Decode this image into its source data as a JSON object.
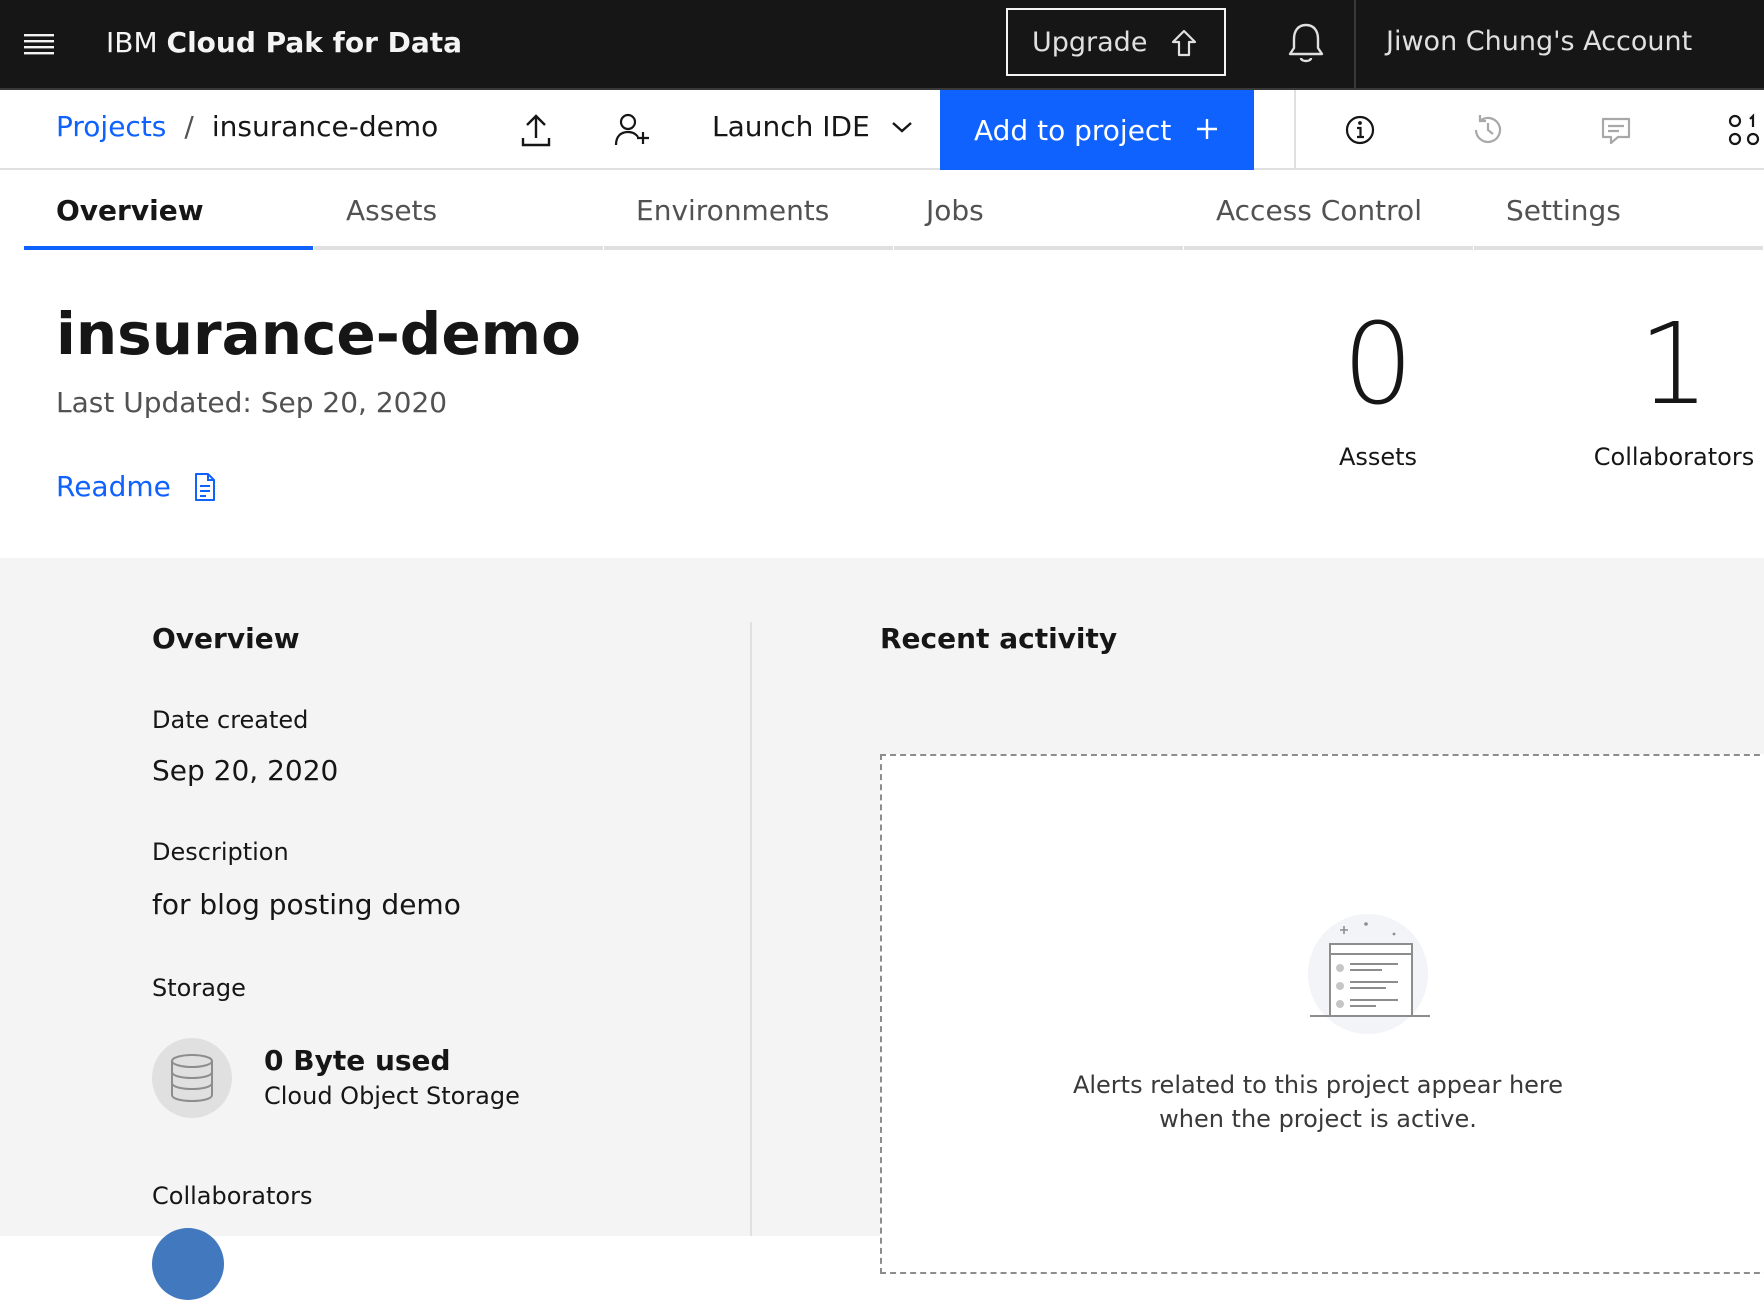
{
  "header": {
    "brand_ibm": "IBM",
    "brand_product": "Cloud Pak for Data",
    "upgrade_label": "Upgrade",
    "account_label": "Jiwon Chung's Account"
  },
  "toolbar": {
    "breadcrumb": {
      "parent": "Projects",
      "separator": "/",
      "current": "insurance-demo"
    },
    "launch_ide_label": "Launch IDE",
    "add_to_project_label": "Add to project"
  },
  "tabs": [
    {
      "label": "Overview",
      "active": true
    },
    {
      "label": "Assets",
      "active": false
    },
    {
      "label": "Environments",
      "active": false
    },
    {
      "label": "Jobs",
      "active": false
    },
    {
      "label": "Access Control",
      "active": false
    },
    {
      "label": "Settings",
      "active": false
    }
  ],
  "project": {
    "title": "insurance-demo",
    "last_updated": "Last Updated: Sep 20, 2020",
    "readme_label": "Readme",
    "stats": [
      {
        "value": "0",
        "label": "Assets"
      },
      {
        "value": "1",
        "label": "Collaborators"
      }
    ]
  },
  "overview": {
    "title": "Overview",
    "date_created_label": "Date created",
    "date_created_value": "Sep 20, 2020",
    "description_label": "Description",
    "description_value": "for blog posting demo",
    "storage_label": "Storage",
    "storage_used": "0 Byte used",
    "storage_type": "Cloud Object Storage",
    "collaborators_label": "Collaborators"
  },
  "recent_activity": {
    "title": "Recent activity",
    "empty_line1": "Alerts related to this project appear here",
    "empty_line2": "when the project is active."
  },
  "icons": {
    "menu": "hamburger-menu-icon",
    "upgrade": "arrow-up-outline-icon",
    "notifications": "bell-icon",
    "upload": "upload-icon",
    "add_collaborator": "user-add-icon",
    "chevron": "chevron-down-icon",
    "plus": "plus-icon",
    "info": "info-icon",
    "history": "history-icon",
    "comments": "comment-icon",
    "apps": "apps-icon",
    "readme": "document-icon",
    "storage": "database-icon"
  },
  "colors": {
    "header_bg": "#161616",
    "primary": "#0f62fe",
    "content_bg": "#f4f4f4",
    "text": "#161616",
    "secondary_text": "#525252"
  }
}
